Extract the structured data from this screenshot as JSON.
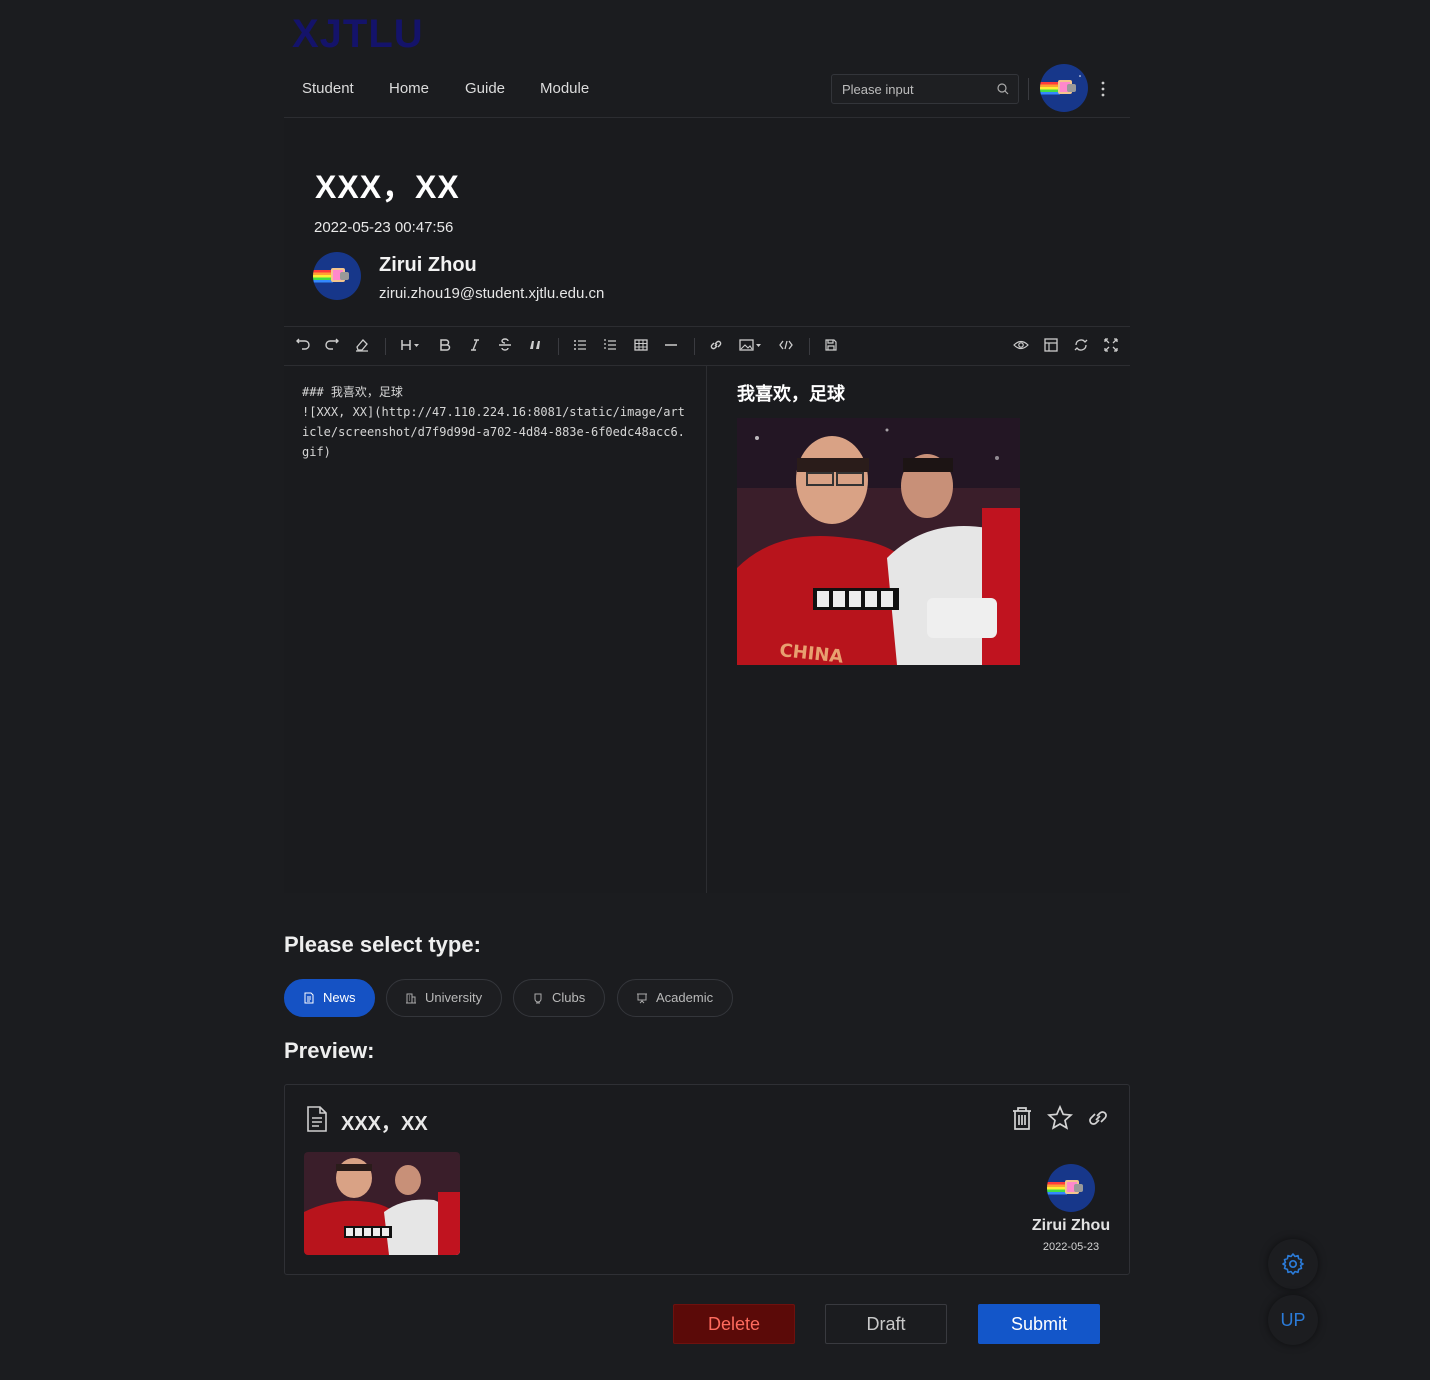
{
  "logo": "XJTLU",
  "nav": {
    "items": [
      "Student",
      "Home",
      "Guide",
      "Module"
    ],
    "search_placeholder": "Please input"
  },
  "article": {
    "title": "XXX，XX",
    "date": "2022-05-23 00:47:56",
    "author_name": "Zirui Zhou",
    "author_email": "zirui.zhou19@student.xjtlu.edu.cn"
  },
  "editor": {
    "markdown": "### 我喜欢，足球\n![XXX, XX](http://47.110.224.16:8081/static/image/article/screenshot/d7f9d99d-a702-4d84-883e-6f0edc48acc6.gif)",
    "preview_heading": "我喜欢，足球",
    "toolbar": [
      "undo-icon",
      "redo-icon",
      "eraser-icon",
      "heading-icon",
      "bold-icon",
      "italic-icon",
      "strikethrough-icon",
      "quote-icon",
      "unordered-list-icon",
      "ordered-list-icon",
      "table-icon",
      "horizontal-rule-icon",
      "link-icon",
      "image-icon",
      "code-icon",
      "save-icon",
      "preview-icon",
      "html-preview-icon",
      "sync-scroll-icon",
      "fullscreen-icon"
    ]
  },
  "type_section": {
    "heading": "Please select type:",
    "types": [
      {
        "label": "News",
        "icon": "document-icon",
        "active": true
      },
      {
        "label": "University",
        "icon": "building-icon",
        "active": false
      },
      {
        "label": "Clubs",
        "icon": "cup-icon",
        "active": false
      },
      {
        "label": "Academic",
        "icon": "presentation-icon",
        "active": false
      }
    ]
  },
  "preview_section": {
    "heading": "Preview:",
    "card_title": "XXX，XX",
    "card_author": "Zirui Zhou",
    "card_date": "2022-05-23"
  },
  "actions": {
    "delete": "Delete",
    "draft": "Draft",
    "submit": "Submit"
  },
  "floating": {
    "up": "UP"
  },
  "colors": {
    "background": "#1b1c1f",
    "accent": "#1356c9",
    "danger": "#5b0a08",
    "logo": "#14136a"
  }
}
